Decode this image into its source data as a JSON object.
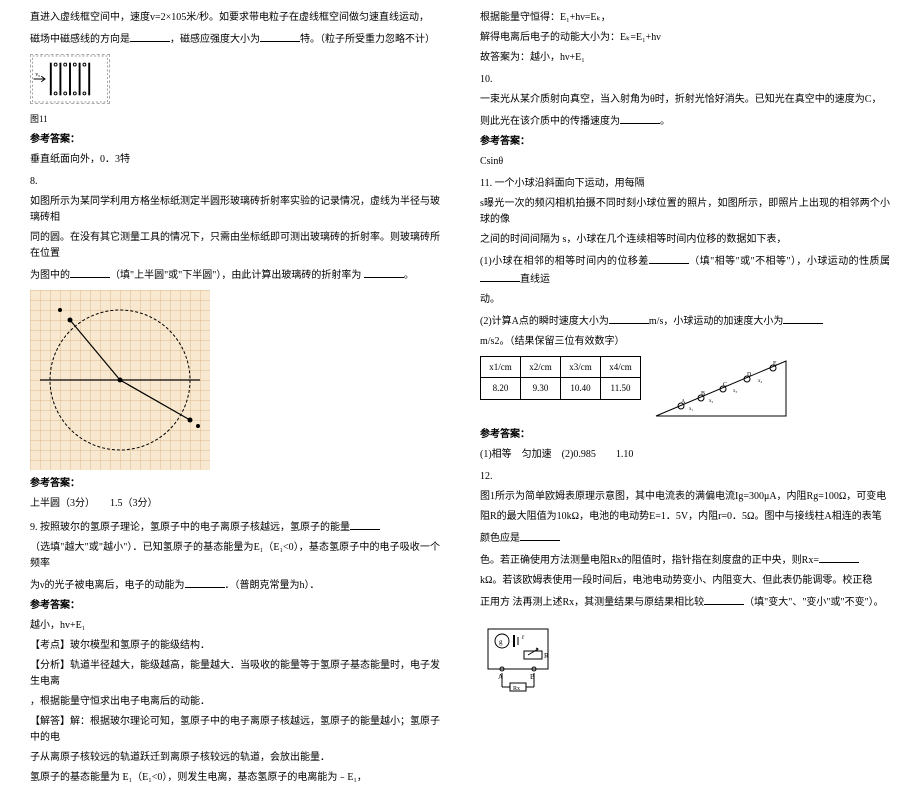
{
  "left": {
    "p1": "直进入虚线框空间中，速度v=2×105米/秒。如要求带电粒子在虚线框空间做匀速直线运动，",
    "p2_a": "磁场中磁感线的方向是",
    "p2_b": "，磁感应强度大小为",
    "p2_c": "特。（粒子所受重力忽略不计）",
    "fig11_cap": "图11",
    "ans_label": "参考答案：",
    "ans7": "垂直纸面向外，0．3特",
    "q8_num": "8.",
    "q8_p1": "如图所示为某同学利用方格坐标纸测定半圆形玻璃砖折射率实验的记录情况，虚线为半径与玻璃砖相",
    "q8_p2_a": "同的圆。在没有其它测量工具的情况下，只需由坐标纸即可测出玻璃砖的折射率。则玻璃砖所在位置",
    "q8_p3_a": "为图中的",
    "q8_p3_b": "（填\"上半圆\"或\"下半圆\"），由此计算出玻璃砖的折射率为",
    "q8_p3_c": "。",
    "ans8": "上半圆（3分）　　1.5（3分）",
    "q9_num": "9. ",
    "q9_p1": "按照玻尔的氢原子理论，氢原子中的电子离原子核越远，氢原子的能量",
    "q9_p2_a": "（选填\"越大\"或\"越小\"）．已知氢原子的基态能量为E₁（E₁<0），基态氢原子中的电子吸收一个频率",
    "q9_p3_a": "为ν的光子被电离后，电子的动能为",
    "q9_p3_b": "．（普朗克常量为h）．",
    "ans9": "越小，hv+E₁",
    "kd_label": "【考点】",
    "kd": "玻尔模型和氢原子的能级结构．",
    "fx_label": "【分析】",
    "fx1": "轨道半径越大，能级越高，能量越大．当吸收的能量等于氢原子基态能量时，电子发生电离",
    "fx2": "，根据能量守恒求出电子电离后的动能．",
    "jd_label": "【解答】",
    "jd1": "解：根据玻尔理论可知，氢原子中的电子离原子核越远，氢原子的能量越小；氢原子中的电",
    "jd2": "子从离原子核较远的轨道跃迁到离原子核较远的轨道，会放出能量．",
    "jd3": "氢原子的基态能量为 E₁（E₁<0），则发生电离，基态氢原子的电离能为﹣E₁，"
  },
  "right": {
    "p1": "根据能量守恒得：E₁+hν=Eₖ，",
    "p2": "解得电离后电子的动能大小为：Eₖ=E₁+hν",
    "p3": "故答案为：越小，hν+E₁",
    "q10_num": "10.",
    "q10_p1": "一束光从某介质射向真空，当入射角为θ时，折射光恰好消失。已知光在真空中的速度为C，",
    "q10_p2_a": "则此光在该介质中的传播速度为",
    "q10_p2_b": "。",
    "ans_label": "参考答案：",
    "ans10": "Csinθ",
    "q11_num": "11. ",
    "q11_p1": "一个小球沿斜面向下运动，用每隔",
    "q11_p2": "s曝光一次的频闪相机拍摄不同时刻小球位置的照片，如图所示，即照片上出现的相邻两个小球的像",
    "q11_p3": "之间的时间间隔为  s，小球在几个连续相等时间内位移的数据如下表，",
    "q11_p4_a": "(1)小球在相邻的相等时间内的位移差",
    "q11_p4_b": "（填\"相等\"或\"不相等\"），小球运动的性质属",
    "q11_p4_c": "直线运",
    "q11_p4_d": "动。",
    "q11_p5_a": "(2)计算A点的瞬时速度大小为",
    "q11_p5_b": "m/s，小球运动的加速度大小为",
    "q11_p6": "m/s2。（结果保留三位有效数字）",
    "tbl": {
      "h1": "x1/cm",
      "h2": "x2/cm",
      "h3": "x3/cm",
      "h4": "x4/cm",
      "v1": "8.20",
      "v2": "9.30",
      "v3": "10.40",
      "v4": "11.50"
    },
    "ans11": "(1)相等　匀加速　(2)0.985　　1.10",
    "q12_num": "12.",
    "q12_p1": "图1所示为简单欧姆表原理示意图，其中电流表的满偏电流Ig=300μA，内阻Rg=100Ω，可变电",
    "q12_p2": "阻R的最大阻值为10kΩ，电池的电动势E=1．5V，内阻r=0．5Ω。图中与接线柱A相连的表笔",
    "q12_p3_a": "颜色应是",
    "q12_p4_a": "色。若正确使用方法测量电阻Rx的阻值时，指针指在刻度盘的正中央，则Rx=",
    "q12_p5": "kΩ。若该欧姆表使用一段时间后，电池电动势变小、内阻变大、但此表仍能调零。校正稳",
    "q12_p6_a": "正用方 法再测上述Rx，其测量结果与原结果相比较",
    "q12_p6_b": "（填\"变大\"、\"变小\"或\"不变\"）。"
  }
}
